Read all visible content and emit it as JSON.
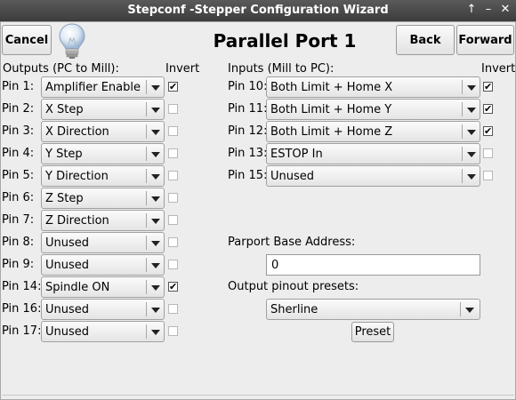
{
  "window": {
    "title": "Stepconf -Stepper Configuration Wizard",
    "icons": {
      "up": "↑",
      "minimize": "–",
      "close": "✕"
    }
  },
  "toolbar": {
    "cancel_label": "Cancel",
    "page_title": "Parallel Port 1",
    "back_label": "Back",
    "forward_label": "Forward"
  },
  "outputs": {
    "header": "Outputs (PC to Mill):",
    "invert_header": "Invert",
    "pins": [
      {
        "label": "Pin 1:",
        "value": "Amplifier Enable",
        "invert": true
      },
      {
        "label": "Pin 2:",
        "value": "X Step",
        "invert": false
      },
      {
        "label": "Pin 3:",
        "value": "X Direction",
        "invert": false
      },
      {
        "label": "Pin 4:",
        "value": "Y Step",
        "invert": false
      },
      {
        "label": "Pin 5:",
        "value": "Y Direction",
        "invert": false
      },
      {
        "label": "Pin 6:",
        "value": "Z Step",
        "invert": false
      },
      {
        "label": "Pin 7:",
        "value": "Z Direction",
        "invert": false
      },
      {
        "label": "Pin 8:",
        "value": "Unused",
        "invert": false
      },
      {
        "label": "Pin 9:",
        "value": "Unused",
        "invert": false
      },
      {
        "label": "Pin 14:",
        "value": "Spindle ON",
        "invert": true
      },
      {
        "label": "Pin 16:",
        "value": "Unused",
        "invert": false
      },
      {
        "label": "Pin 17:",
        "value": "Unused",
        "invert": false
      }
    ]
  },
  "inputs": {
    "header": "Inputs (Mill to PC):",
    "invert_header": "Invert",
    "pins": [
      {
        "label": "Pin 10:",
        "value": "Both Limit + Home X",
        "invert": true
      },
      {
        "label": "Pin 11:",
        "value": "Both Limit + Home Y",
        "invert": true
      },
      {
        "label": "Pin 12:",
        "value": "Both Limit + Home Z",
        "invert": true
      },
      {
        "label": "Pin 13:",
        "value": "ESTOP In",
        "invert": false
      },
      {
        "label": "Pin 15:",
        "value": "Unused",
        "invert": false
      }
    ]
  },
  "parport": {
    "base_label": "Parport Base Address:",
    "base_value": "0",
    "presets_label": "Output pinout presets:",
    "preset_value": "Sherline",
    "preset_button": "Preset"
  },
  "colors": {
    "titlebar": "#4a4a4a",
    "window_bg": "#ededed"
  }
}
